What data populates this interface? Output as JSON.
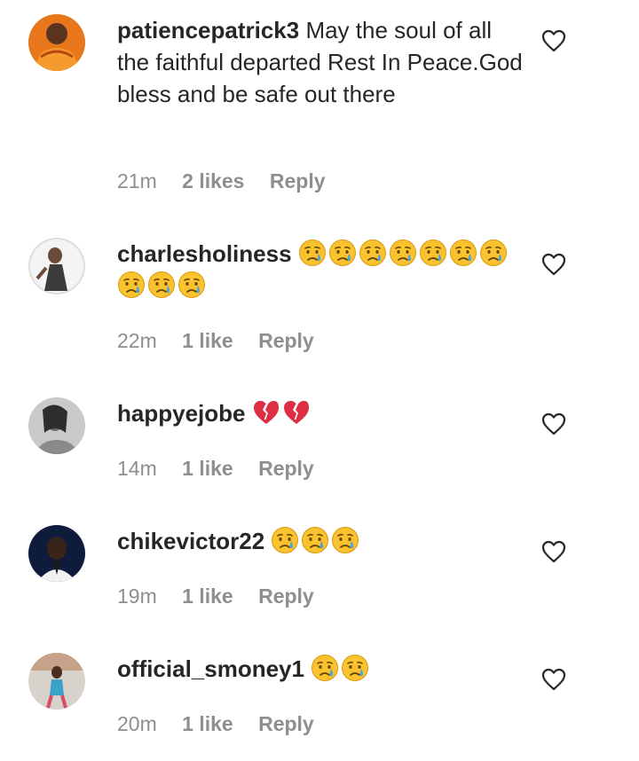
{
  "comments": [
    {
      "username": "patiencepatrick3",
      "text": " May the soul of all the faithful departed Rest In Peace.God bless and be safe out there",
      "time": "21m",
      "likes": "2 likes",
      "reply": "Reply",
      "emoji": []
    },
    {
      "username": "charlesholiness",
      "text": "",
      "time": "22m",
      "likes": "1 like",
      "reply": "Reply",
      "emoji": [
        "crying-face-emoji",
        "crying-face-emoji",
        "crying-face-emoji",
        "crying-face-emoji",
        "crying-face-emoji",
        "crying-face-emoji",
        "crying-face-emoji",
        "crying-face-emoji",
        "crying-face-emoji",
        "crying-face-emoji"
      ]
    },
    {
      "username": "happyejobe",
      "text": "",
      "time": "14m",
      "likes": "1 like",
      "reply": "Reply",
      "emoji": [
        "broken-heart-emoji",
        "broken-heart-emoji"
      ]
    },
    {
      "username": "chikevictor22",
      "text": "",
      "time": "19m",
      "likes": "1 like",
      "reply": "Reply",
      "emoji": [
        "crying-face-emoji",
        "crying-face-emoji",
        "crying-face-emoji"
      ]
    },
    {
      "username": "official_smoney1",
      "text": "",
      "time": "20m",
      "likes": "1 like",
      "reply": "Reply",
      "emoji": [
        "crying-face-emoji",
        "crying-face-emoji"
      ]
    }
  ],
  "colors": {
    "text": "#262626",
    "meta": "#8e8e8e",
    "emoji_yellow": "#f9c22e",
    "tear_blue": "#4aa3df",
    "broken_heart": "#dd2e44"
  }
}
